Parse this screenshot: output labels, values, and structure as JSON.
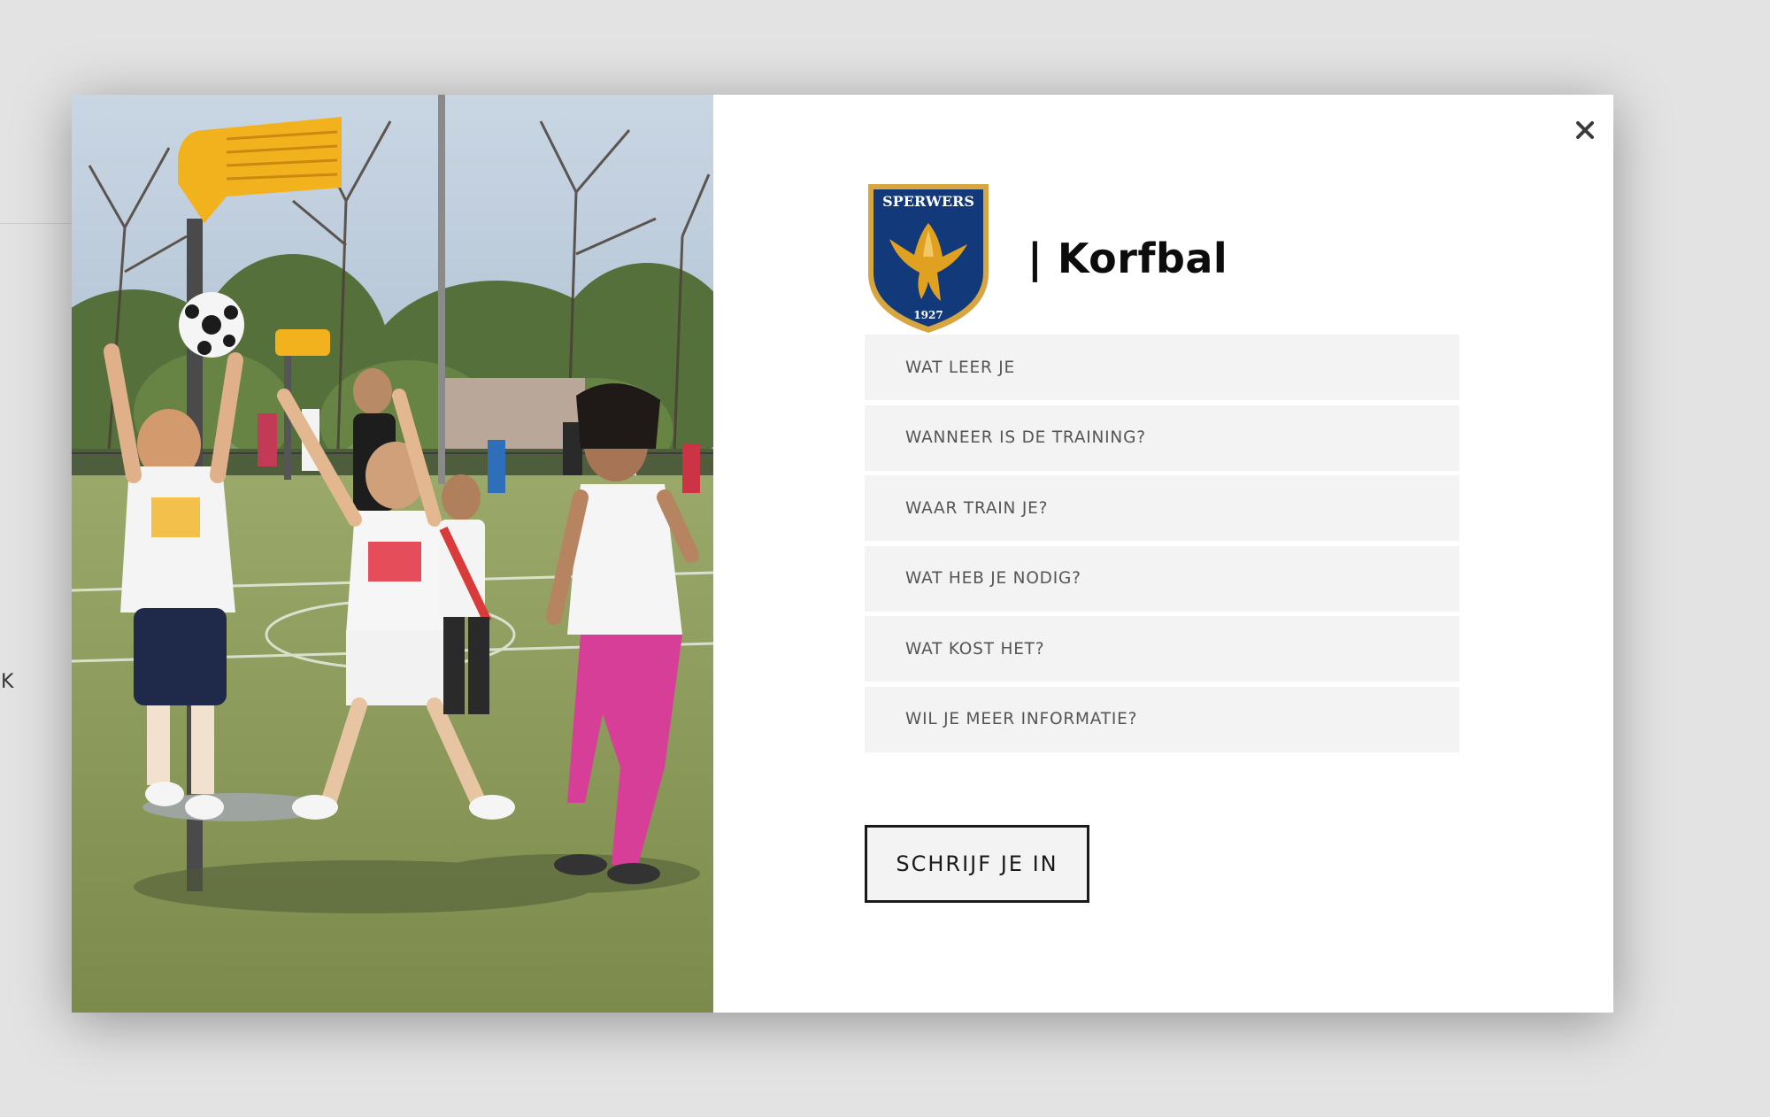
{
  "background": {
    "edge_letter": "K"
  },
  "modal": {
    "close_symbol": "×",
    "close_icon": "close-icon",
    "photo_alt": "Kinderen spelen korfbal op een grasveld",
    "brand": {
      "crest_top_text": "SPERWERS",
      "crest_year": "1927",
      "title": "| Korfbal"
    },
    "faq": [
      {
        "label": "WAT LEER JE"
      },
      {
        "label": "WANNEER IS DE TRAINING?"
      },
      {
        "label": "WAAR TRAIN JE?"
      },
      {
        "label": "WAT HEB JE NODIG?"
      },
      {
        "label": "WAT KOST HET?"
      },
      {
        "label": "WIL JE MEER INFORMATIE?"
      }
    ],
    "cta_label": "SCHRIJF JE IN"
  },
  "colors": {
    "crest_navy": "#123a7a",
    "crest_gold": "#e0a020",
    "korf_yellow": "#f2b21e",
    "faq_bg": "#f3f3f3",
    "overlay_bg": "#e3e3e3"
  }
}
